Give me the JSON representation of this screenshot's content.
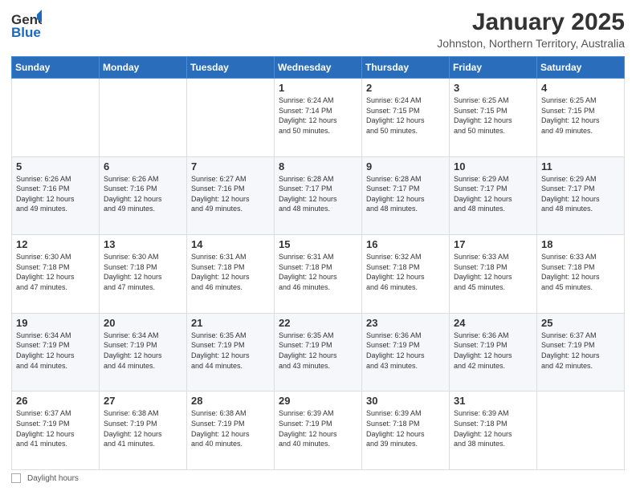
{
  "header": {
    "logo_general": "General",
    "logo_blue": "Blue",
    "month_title": "January 2025",
    "subtitle": "Johnston, Northern Territory, Australia"
  },
  "weekdays": [
    "Sunday",
    "Monday",
    "Tuesday",
    "Wednesday",
    "Thursday",
    "Friday",
    "Saturday"
  ],
  "weeks": [
    [
      {
        "day": "",
        "info": ""
      },
      {
        "day": "",
        "info": ""
      },
      {
        "day": "",
        "info": ""
      },
      {
        "day": "1",
        "info": "Sunrise: 6:24 AM\nSunset: 7:14 PM\nDaylight: 12 hours\nand 50 minutes."
      },
      {
        "day": "2",
        "info": "Sunrise: 6:24 AM\nSunset: 7:15 PM\nDaylight: 12 hours\nand 50 minutes."
      },
      {
        "day": "3",
        "info": "Sunrise: 6:25 AM\nSunset: 7:15 PM\nDaylight: 12 hours\nand 50 minutes."
      },
      {
        "day": "4",
        "info": "Sunrise: 6:25 AM\nSunset: 7:15 PM\nDaylight: 12 hours\nand 49 minutes."
      }
    ],
    [
      {
        "day": "5",
        "info": "Sunrise: 6:26 AM\nSunset: 7:16 PM\nDaylight: 12 hours\nand 49 minutes."
      },
      {
        "day": "6",
        "info": "Sunrise: 6:26 AM\nSunset: 7:16 PM\nDaylight: 12 hours\nand 49 minutes."
      },
      {
        "day": "7",
        "info": "Sunrise: 6:27 AM\nSunset: 7:16 PM\nDaylight: 12 hours\nand 49 minutes."
      },
      {
        "day": "8",
        "info": "Sunrise: 6:28 AM\nSunset: 7:17 PM\nDaylight: 12 hours\nand 48 minutes."
      },
      {
        "day": "9",
        "info": "Sunrise: 6:28 AM\nSunset: 7:17 PM\nDaylight: 12 hours\nand 48 minutes."
      },
      {
        "day": "10",
        "info": "Sunrise: 6:29 AM\nSunset: 7:17 PM\nDaylight: 12 hours\nand 48 minutes."
      },
      {
        "day": "11",
        "info": "Sunrise: 6:29 AM\nSunset: 7:17 PM\nDaylight: 12 hours\nand 48 minutes."
      }
    ],
    [
      {
        "day": "12",
        "info": "Sunrise: 6:30 AM\nSunset: 7:18 PM\nDaylight: 12 hours\nand 47 minutes."
      },
      {
        "day": "13",
        "info": "Sunrise: 6:30 AM\nSunset: 7:18 PM\nDaylight: 12 hours\nand 47 minutes."
      },
      {
        "day": "14",
        "info": "Sunrise: 6:31 AM\nSunset: 7:18 PM\nDaylight: 12 hours\nand 46 minutes."
      },
      {
        "day": "15",
        "info": "Sunrise: 6:31 AM\nSunset: 7:18 PM\nDaylight: 12 hours\nand 46 minutes."
      },
      {
        "day": "16",
        "info": "Sunrise: 6:32 AM\nSunset: 7:18 PM\nDaylight: 12 hours\nand 46 minutes."
      },
      {
        "day": "17",
        "info": "Sunrise: 6:33 AM\nSunset: 7:18 PM\nDaylight: 12 hours\nand 45 minutes."
      },
      {
        "day": "18",
        "info": "Sunrise: 6:33 AM\nSunset: 7:18 PM\nDaylight: 12 hours\nand 45 minutes."
      }
    ],
    [
      {
        "day": "19",
        "info": "Sunrise: 6:34 AM\nSunset: 7:19 PM\nDaylight: 12 hours\nand 44 minutes."
      },
      {
        "day": "20",
        "info": "Sunrise: 6:34 AM\nSunset: 7:19 PM\nDaylight: 12 hours\nand 44 minutes."
      },
      {
        "day": "21",
        "info": "Sunrise: 6:35 AM\nSunset: 7:19 PM\nDaylight: 12 hours\nand 44 minutes."
      },
      {
        "day": "22",
        "info": "Sunrise: 6:35 AM\nSunset: 7:19 PM\nDaylight: 12 hours\nand 43 minutes."
      },
      {
        "day": "23",
        "info": "Sunrise: 6:36 AM\nSunset: 7:19 PM\nDaylight: 12 hours\nand 43 minutes."
      },
      {
        "day": "24",
        "info": "Sunrise: 6:36 AM\nSunset: 7:19 PM\nDaylight: 12 hours\nand 42 minutes."
      },
      {
        "day": "25",
        "info": "Sunrise: 6:37 AM\nSunset: 7:19 PM\nDaylight: 12 hours\nand 42 minutes."
      }
    ],
    [
      {
        "day": "26",
        "info": "Sunrise: 6:37 AM\nSunset: 7:19 PM\nDaylight: 12 hours\nand 41 minutes."
      },
      {
        "day": "27",
        "info": "Sunrise: 6:38 AM\nSunset: 7:19 PM\nDaylight: 12 hours\nand 41 minutes."
      },
      {
        "day": "28",
        "info": "Sunrise: 6:38 AM\nSunset: 7:19 PM\nDaylight: 12 hours\nand 40 minutes."
      },
      {
        "day": "29",
        "info": "Sunrise: 6:39 AM\nSunset: 7:19 PM\nDaylight: 12 hours\nand 40 minutes."
      },
      {
        "day": "30",
        "info": "Sunrise: 6:39 AM\nSunset: 7:18 PM\nDaylight: 12 hours\nand 39 minutes."
      },
      {
        "day": "31",
        "info": "Sunrise: 6:39 AM\nSunset: 7:18 PM\nDaylight: 12 hours\nand 38 minutes."
      },
      {
        "day": "",
        "info": ""
      }
    ]
  ],
  "footer": {
    "daylight_label": "Daylight hours"
  }
}
